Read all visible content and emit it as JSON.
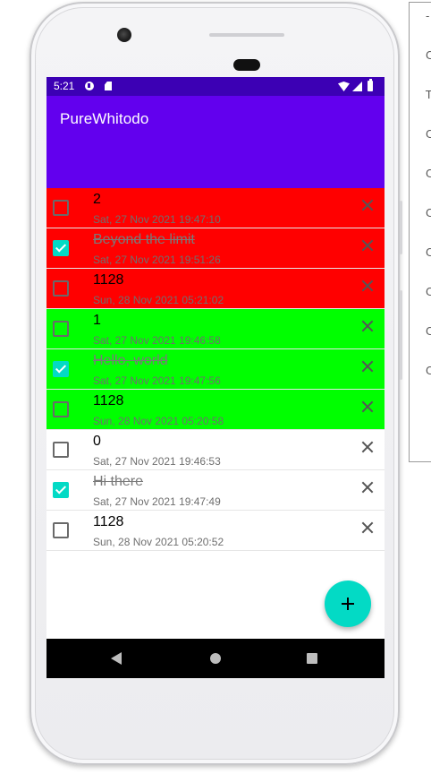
{
  "status_bar": {
    "time": "5:21"
  },
  "app_bar": {
    "title": "PureWhitodo"
  },
  "colors": {
    "status_bar": "#3c00b4",
    "app_bar": "#6200ee",
    "accent": "#03dac5",
    "red": "#ff0000",
    "green": "#00ff00",
    "white": "#ffffff"
  },
  "todos": [
    {
      "text": "2",
      "date": "Sat, 27 Nov 2021 19:47:10",
      "done": false,
      "color": "#ff0000"
    },
    {
      "text": "Beyond the limit",
      "date": "Sat, 27 Nov 2021 19:51:26",
      "done": true,
      "color": "#ff0000"
    },
    {
      "text": "1128",
      "date": "Sun, 28 Nov 2021 05:21:02",
      "done": false,
      "color": "#ff0000"
    },
    {
      "text": "1",
      "date": "Sat, 27 Nov 2021 19:46:58",
      "done": false,
      "color": "#00ff00"
    },
    {
      "text": "Hello, world",
      "date": "Sat, 27 Nov 2021 19:47:56",
      "done": true,
      "color": "#00ff00"
    },
    {
      "text": "1128",
      "date": "Sun, 28 Nov 2021 05:20:58",
      "done": false,
      "color": "#00ff00"
    },
    {
      "text": "0",
      "date": "Sat, 27 Nov 2021 19:46:53",
      "done": false,
      "color": "#ffffff"
    },
    {
      "text": "Hi there",
      "date": "Sat, 27 Nov 2021 19:47:49",
      "done": true,
      "color": "#ffffff"
    },
    {
      "text": "1128",
      "date": "Sun, 28 Nov 2021 05:20:52",
      "done": false,
      "color": "#ffffff"
    }
  ],
  "icons": {
    "delete": "close-icon",
    "fab": "plus-icon",
    "back": "back-triangle-icon",
    "home": "home-circle-icon",
    "recents": "recents-square-icon"
  },
  "side_panel": {
    "glyphs": [
      "-",
      "C",
      "T",
      "C",
      "C",
      "C",
      "C",
      "C",
      "C",
      "C"
    ]
  }
}
